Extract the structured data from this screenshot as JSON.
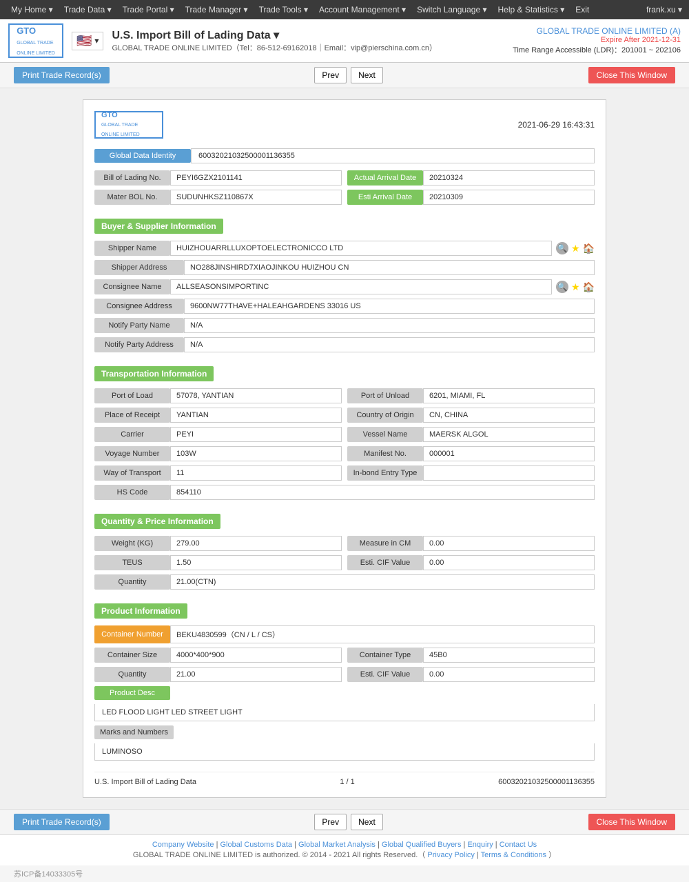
{
  "topnav": {
    "items": [
      {
        "label": "My Home ▾"
      },
      {
        "label": "Trade Data ▾"
      },
      {
        "label": "Trade Portal ▾"
      },
      {
        "label": "Trade Manager ▾"
      },
      {
        "label": "Trade Tools ▾"
      },
      {
        "label": "Account Management ▾"
      },
      {
        "label": "Switch Language ▾"
      },
      {
        "label": "Help & Statistics ▾"
      },
      {
        "label": "Exit"
      }
    ],
    "user": "frank.xu ▾"
  },
  "header": {
    "logo_line1": "GTO",
    "logo_line2": "GLOBAL TRADE ONLINE LIMITED",
    "title": "U.S. Import Bill of Lading Data ▾",
    "subtitle": "GLOBAL TRADE ONLINE LIMITED（Tel：86-512-69162018｜Email：vip@pierschina.com.cn）",
    "company": "GLOBAL TRADE ONLINE LIMITED (A)",
    "expire": "Expire After 2021-12-31",
    "range": "Time Range Accessible (LDR)：201001 ~ 202106"
  },
  "toolbar": {
    "print_label": "Print Trade Record(s)",
    "prev_label": "Prev",
    "next_label": "Next",
    "close_label": "Close This Window"
  },
  "record": {
    "timestamp": "2021-06-29 16:43:31",
    "global_data_identity_label": "Global Data Identity",
    "global_data_identity_value": "60032021032500001136355",
    "bill_of_lading_label": "Bill of Lading No.",
    "bill_of_lading_value": "PEYI6GZX2101141",
    "actual_arrival_date_label": "Actual Arrival Date",
    "actual_arrival_date_value": "20210324",
    "mater_bol_label": "Mater BOL No.",
    "mater_bol_value": "SUDUNHKSZ110867X",
    "esti_arrival_label": "Esti Arrival Date",
    "esti_arrival_value": "20210309",
    "buyer_supplier_header": "Buyer & Supplier Information",
    "shipper_name_label": "Shipper Name",
    "shipper_name_value": "HUIZHOUARRLLUXOPTOELECTRONICCO LTD",
    "shipper_address_label": "Shipper Address",
    "shipper_address_value": "NO288JINSHIRD7XIAOJINKOU HUIZHOU CN",
    "consignee_name_label": "Consignee Name",
    "consignee_name_value": "ALLSEASONSIMPORTINC",
    "consignee_address_label": "Consignee Address",
    "consignee_address_value": "9600NW77THAVE+HALEAHGARDENS 33016 US",
    "notify_party_name_label": "Notify Party Name",
    "notify_party_name_value": "N/A",
    "notify_party_address_label": "Notify Party Address",
    "notify_party_address_value": "N/A",
    "transport_header": "Transportation Information",
    "port_of_load_label": "Port of Load",
    "port_of_load_value": "57078, YANTIAN",
    "port_of_unload_label": "Port of Unload",
    "port_of_unload_value": "6201, MIAMI, FL",
    "place_of_receipt_label": "Place of Receipt",
    "place_of_receipt_value": "YANTIAN",
    "country_of_origin_label": "Country of Origin",
    "country_of_origin_value": "CN, CHINA",
    "carrier_label": "Carrier",
    "carrier_value": "PEYI",
    "vessel_name_label": "Vessel Name",
    "vessel_name_value": "MAERSK ALGOL",
    "voyage_number_label": "Voyage Number",
    "voyage_number_value": "103W",
    "manifest_no_label": "Manifest No.",
    "manifest_no_value": "000001",
    "way_of_transport_label": "Way of Transport",
    "way_of_transport_value": "11",
    "inbond_entry_type_label": "In-bond Entry Type",
    "inbond_entry_type_value": "",
    "hs_code_label": "HS Code",
    "hs_code_value": "854110",
    "quantity_price_header": "Quantity & Price Information",
    "weight_kg_label": "Weight (KG)",
    "weight_kg_value": "279.00",
    "measure_in_cm_label": "Measure in CM",
    "measure_in_cm_value": "0.00",
    "teus_label": "TEUS",
    "teus_value": "1.50",
    "esti_cif_value_label": "Esti. CIF Value",
    "esti_cif_value_value": "0.00",
    "quantity_label": "Quantity",
    "quantity_value": "21.00(CTN)",
    "product_header": "Product Information",
    "container_number_label": "Container Number",
    "container_number_value": "BEKU4830599（CN / L / CS）",
    "container_size_label": "Container Size",
    "container_size_value": "4000*400*900",
    "container_type_label": "Container Type",
    "container_type_value": "45B0",
    "quantity2_label": "Quantity",
    "quantity2_value": "21.00",
    "esti_cif2_label": "Esti. CIF Value",
    "esti_cif2_value": "0.00",
    "product_desc_label": "Product Desc",
    "product_desc_value": "LED FLOOD LIGHT LED STREET LIGHT",
    "marks_numbers_label": "Marks and Numbers",
    "marks_numbers_value": "LUMINOSO",
    "footer_title": "U.S. Import Bill of Lading Data",
    "footer_page": "1 / 1",
    "footer_id": "60032021032500001136355"
  },
  "bottom_toolbar": {
    "print_label": "Print Trade Record(s)",
    "prev_label": "Prev",
    "next_label": "Next",
    "close_label": "Close This Window"
  },
  "site_footer": {
    "links": [
      "Company Website",
      "Global Customs Data",
      "Global Market Analysis",
      "Global Qualified Buyers",
      "Enquiry",
      "Contact Us"
    ],
    "copyright": "GLOBAL TRADE ONLINE LIMITED is authorized. © 2014 - 2021 All rights Reserved.（",
    "privacy": "Privacy Policy",
    "separator": "|",
    "terms": "Terms & Conditions",
    "copyright_end": "）",
    "icp": "苏ICP备14033305号"
  }
}
